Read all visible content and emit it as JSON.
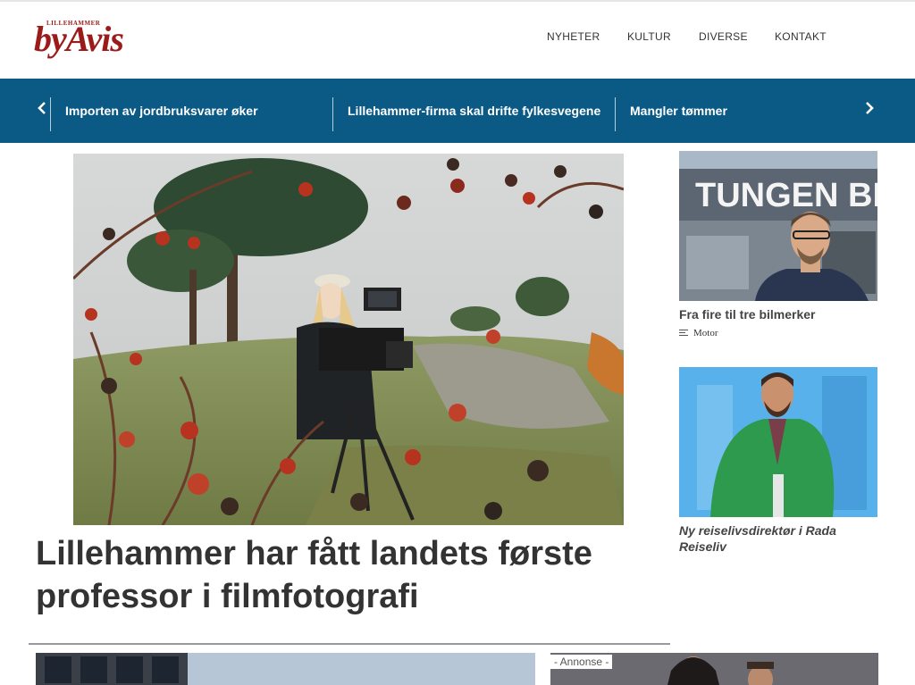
{
  "header": {
    "logo_small": "LILLEHAMMER",
    "logo_big": "byAvis",
    "nav": [
      "NYHETER",
      "KULTUR",
      "DIVERSE",
      "KONTAKT"
    ]
  },
  "ticker": {
    "prev_icon": "chevron-left-icon",
    "next_icon": "chevron-right-icon",
    "items": [
      "Importen av jordbruksvarer øker",
      "Lillehammer-firma skal drifte fylkesvegene",
      "Mangler tømmer"
    ]
  },
  "main": {
    "headline": "Lillehammer har fått landets første professor i filmfotografi"
  },
  "sidebar": [
    {
      "title": "Fra fire til tre bilmerker",
      "category": "Motor",
      "sign_text": "TUNGEN BI"
    },
    {
      "title": "Ny reiselivsdirektør i Rada Reiseliv",
      "category": ""
    }
  ],
  "bottom": {
    "ad_label": "- Annonse -"
  },
  "colors": {
    "brand_red": "#9b1b1b",
    "ticker_blue": "#0b5a86"
  }
}
